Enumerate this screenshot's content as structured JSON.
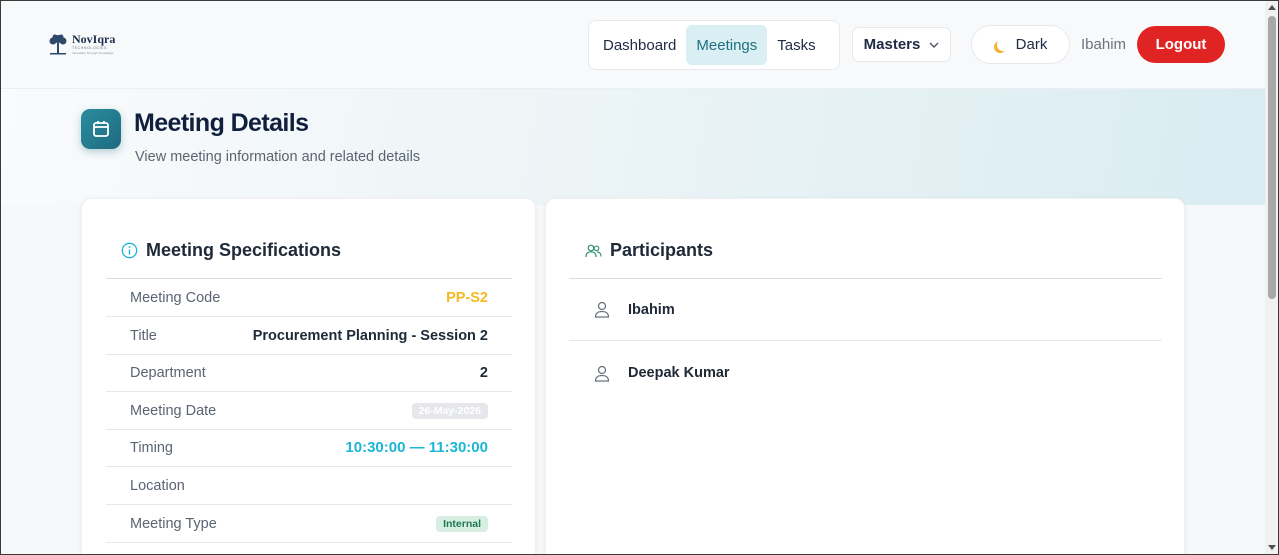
{
  "app": {
    "logo_name": "NovIqra",
    "logo_sub": "TECHNOLOGIES",
    "logo_tagline": "Innovation Through Knowledge"
  },
  "nav": {
    "items": [
      {
        "label": "Dashboard",
        "active": false
      },
      {
        "label": "Meetings",
        "active": true
      },
      {
        "label": "Tasks",
        "active": false
      }
    ],
    "masters_label": "Masters",
    "theme_label": "Dark",
    "username": "Ibahim",
    "logout_label": "Logout"
  },
  "page": {
    "title": "Meeting Details",
    "subtitle": "View meeting information and related details"
  },
  "specs": {
    "heading": "Meeting Specifications",
    "rows": [
      {
        "label": "Meeting Code",
        "value": "PP-S2"
      },
      {
        "label": "Title",
        "value": "Procurement Planning - Session 2"
      },
      {
        "label": "Department",
        "value": "2"
      },
      {
        "label": "Meeting Date",
        "value": "26-May-2026"
      },
      {
        "label": "Timing",
        "value": "10:30:00 — 11:30:00"
      },
      {
        "label": "Location",
        "value": ""
      },
      {
        "label": "Meeting Type",
        "value": "Internal"
      }
    ]
  },
  "participants": {
    "heading": "Participants",
    "people": [
      {
        "name": "Ibahim"
      },
      {
        "name": "Deepak Kumar"
      }
    ]
  },
  "colors": {
    "accent": "#1f6f82",
    "logout": "#e02424",
    "code": "#f5b820",
    "timing": "#1ab6d6",
    "type_badge_bg": "#d7efe2",
    "type_badge_fg": "#1f7a4d"
  },
  "icons": {
    "logo": "tree-icon",
    "theme": "moon-icon",
    "masters": "chevron-down-icon",
    "hero": "calendar-icon",
    "specs": "info-icon",
    "participants": "users-icon",
    "person": "user-icon"
  }
}
